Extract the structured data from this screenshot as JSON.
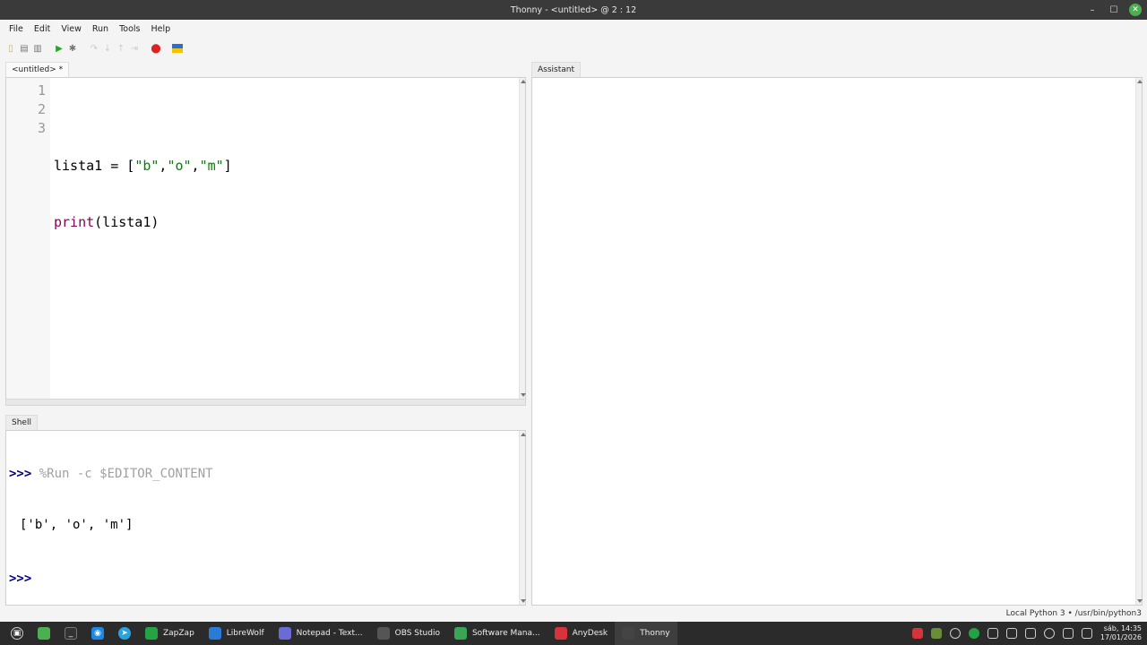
{
  "window": {
    "title": "Thonny - <untitled> @ 2 : 12"
  },
  "menu": [
    "File",
    "Edit",
    "View",
    "Run",
    "Tools",
    "Help"
  ],
  "editor": {
    "tab_label": "<untitled> *",
    "line_numbers": [
      "1",
      "2",
      "3"
    ],
    "lines": [
      "",
      "lista1 = [\"b\",\"o\",\"m\"]",
      "print(lista1)"
    ]
  },
  "shell": {
    "tab_label": "Shell",
    "prompt": ">>>",
    "command": "%Run -c $EDITOR_CONTENT",
    "output": "['b', 'o', 'm']",
    "prompt2": ">>>"
  },
  "assistant": {
    "tab_label": "Assistant"
  },
  "status": {
    "interpreter": "Local Python 3 • /usr/bin/python3"
  },
  "taskbar": {
    "apps": [
      {
        "label": "ZapZap",
        "color": "#25a244"
      },
      {
        "label": "LibreWolf",
        "color": "#2a7bd8"
      },
      {
        "label": "Notepad - Text...",
        "color": "#6b6bd6"
      },
      {
        "label": "OBS Studio",
        "color": "#555555"
      },
      {
        "label": "Software Mana...",
        "color": "#3aa655"
      },
      {
        "label": "AnyDesk",
        "color": "#d6333a"
      },
      {
        "label": "Thonny",
        "color": "#444444"
      }
    ],
    "clock_day": "sáb, 14:35",
    "clock_date": "17/01/2026"
  }
}
